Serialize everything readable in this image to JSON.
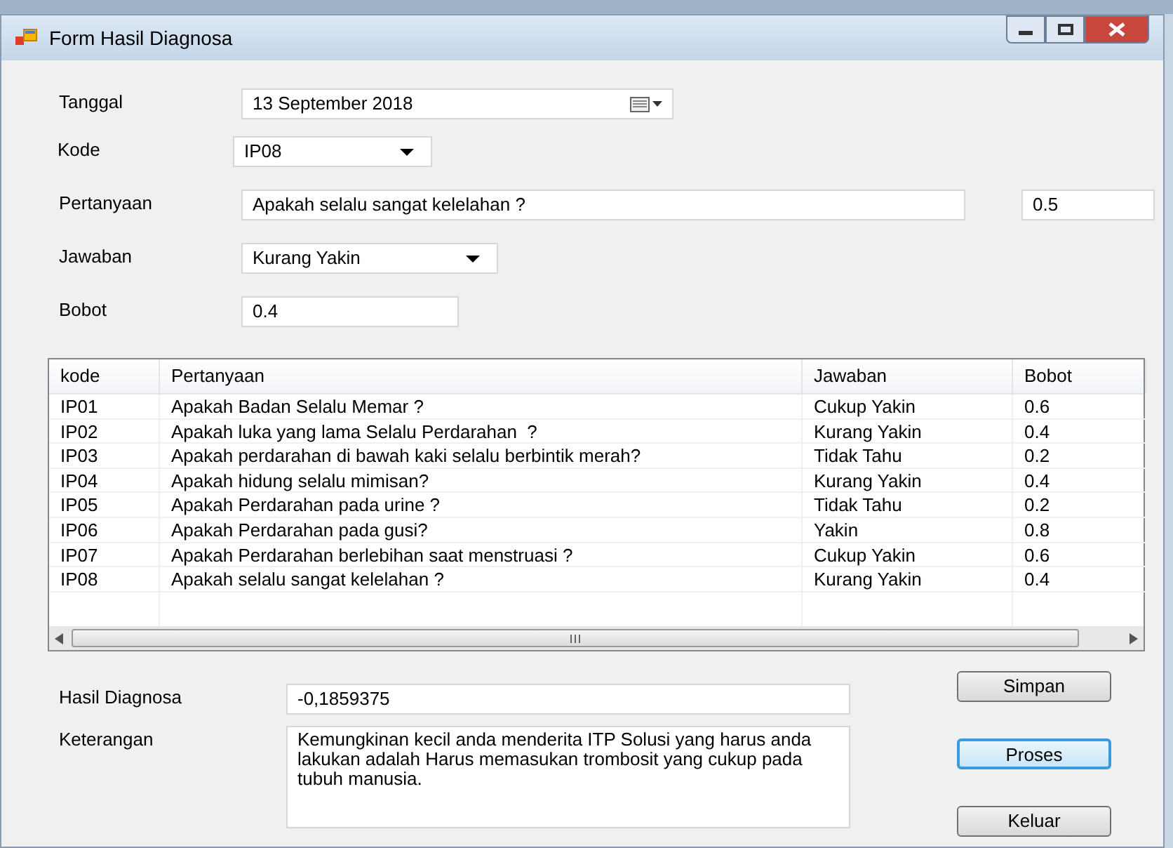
{
  "window": {
    "title": "Form Hasil Diagnosa"
  },
  "form": {
    "tanggal": {
      "label": "Tanggal",
      "value": "13 September 2018"
    },
    "kode": {
      "label": "Kode",
      "value": "IP08"
    },
    "pertanyaan": {
      "label": "Pertanyaan",
      "value": "Apakah selalu sangat kelelahan ?",
      "extra_value": "0.5"
    },
    "jawaban": {
      "label": "Jawaban",
      "value": "Kurang Yakin"
    },
    "bobot": {
      "label": "Bobot",
      "value": "0.4"
    }
  },
  "table": {
    "columns": [
      "kode",
      "Pertanyaan",
      "Jawaban",
      "Bobot"
    ],
    "rows": [
      [
        "IP01",
        "Apakah Badan Selalu Memar ?",
        "Cukup Yakin",
        "0.6"
      ],
      [
        "IP02",
        "Apakah luka yang lama Selalu Perdarahan  ?",
        "Kurang Yakin",
        "0.4"
      ],
      [
        "IP03",
        "Apakah perdarahan di bawah kaki selalu berbintik merah?",
        "Tidak Tahu",
        "0.2"
      ],
      [
        "IP04",
        "Apakah hidung selalu mimisan?",
        "Kurang Yakin",
        "0.4"
      ],
      [
        "IP05",
        "Apakah Perdarahan pada urine ?",
        "Tidak Tahu",
        "0.2"
      ],
      [
        "IP06",
        "Apakah Perdarahan pada gusi?",
        "Yakin",
        "0.8"
      ],
      [
        "IP07",
        "Apakah Perdarahan berlebihan saat menstruasi ?",
        "Cukup Yakin",
        "0.6"
      ],
      [
        "IP08",
        "Apakah selalu sangat kelelahan ?",
        "Kurang Yakin",
        "0.4"
      ]
    ]
  },
  "result": {
    "hasil": {
      "label": "Hasil Diagnosa",
      "value": "-0,1859375"
    },
    "keterangan": {
      "label": "Keterangan",
      "value": "Kemungkinan kecil anda menderita ITP Solusi yang harus anda lakukan adalah Harus memasukan trombosit yang cukup pada tubuh manusia."
    }
  },
  "buttons": [
    {
      "label": "Simpan",
      "focused": false
    },
    {
      "label": "Proses",
      "focused": true
    },
    {
      "label": "Keluar",
      "focused": false
    }
  ]
}
